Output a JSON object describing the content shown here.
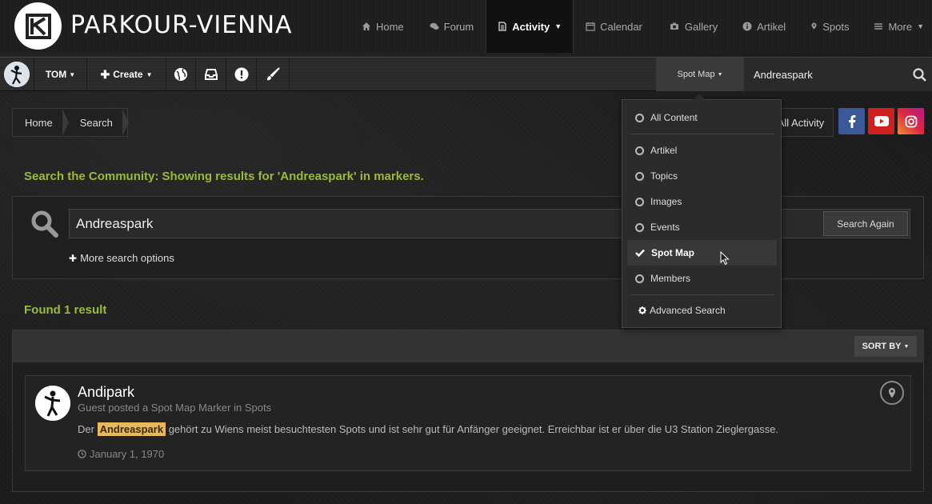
{
  "header": {
    "site_title": "PARKOUR-VIENNA",
    "nav": [
      {
        "label": "Home",
        "icon": "home-icon"
      },
      {
        "label": "Forum",
        "icon": "comments-icon"
      },
      {
        "label": "Activity",
        "icon": "file-icon",
        "active": true
      },
      {
        "label": "Calendar",
        "icon": "calendar-icon"
      },
      {
        "label": "Gallery",
        "icon": "camera-icon"
      },
      {
        "label": "Artikel",
        "icon": "info-icon"
      },
      {
        "label": "Spots",
        "icon": "map-marker-icon"
      },
      {
        "label": "More",
        "icon": "bars-icon"
      }
    ]
  },
  "userbar": {
    "username": "TOM",
    "create_label": "Create",
    "search_scope": "Spot Map",
    "search_value": "Andreaspark"
  },
  "breadcrumb": [
    "Home",
    "Search"
  ],
  "all_activity": "All Activity",
  "colors": {
    "accent": "#9bbb34",
    "facebook": "#3b5998",
    "youtube": "#cd201f",
    "highlight": "#e8b85a"
  },
  "search": {
    "heading": "Search the Community: Showing results for 'Andreaspark' in markers.",
    "query": "Andreaspark",
    "button": "Search Again",
    "more_options": "More search options"
  },
  "results": {
    "found": "Found 1 result",
    "sort_label": "SORT BY",
    "items": [
      {
        "title": "Andipark",
        "meta": "Guest posted a Spot Map Marker in Spots",
        "snippet_before": "Der",
        "snippet_highlight": "Andreaspark",
        "snippet_after": "gehört zu Wiens meist besuchtesten Spots und ist sehr gut für Anfänger geeignet. Erreichbar ist er über die U3 Station Zieglergasse.",
        "date": "January 1, 1970"
      }
    ]
  },
  "dropdown": {
    "items": [
      "All Content",
      "Artikel",
      "Topics",
      "Images",
      "Events",
      "Spot Map",
      "Members"
    ],
    "selected": "Spot Map",
    "advanced": "Advanced Search"
  }
}
